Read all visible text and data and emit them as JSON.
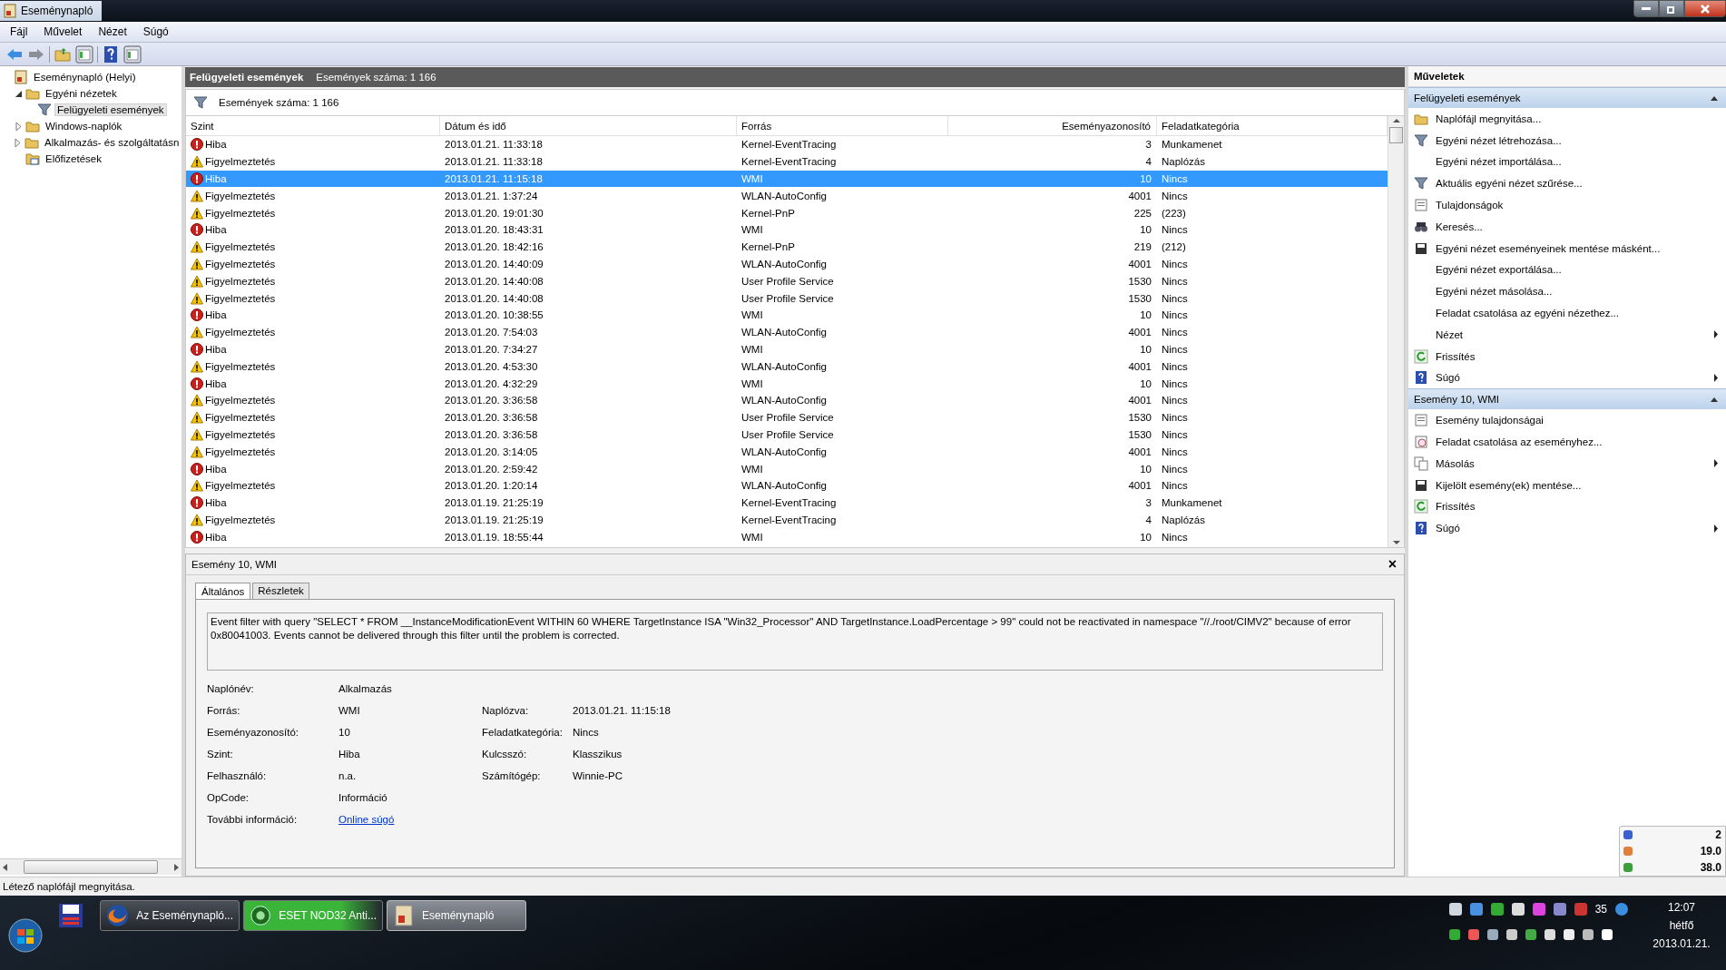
{
  "window": {
    "title": "Eseménynapló"
  },
  "menu": [
    "Fájl",
    "Művelet",
    "Nézet",
    "Súgó"
  ],
  "toolbar": [
    {
      "kind": "back"
    },
    {
      "kind": "forward"
    },
    {
      "kind": "sep"
    },
    {
      "kind": "folder-up"
    },
    {
      "kind": "pane"
    },
    {
      "kind": "sep"
    },
    {
      "kind": "help"
    },
    {
      "kind": "pane"
    }
  ],
  "tree": [
    {
      "label": "Eseménynapló (Helyi)",
      "kind": "root",
      "selected": false,
      "children": [
        {
          "label": "Egyéni nézetek",
          "kind": "folder",
          "expanded": true,
          "selected": false,
          "children": [
            {
              "label": "Felügyeleti események",
              "kind": "filter",
              "selected": true
            }
          ]
        },
        {
          "label": "Windows-naplók",
          "kind": "folder",
          "expanded": false,
          "selected": false
        },
        {
          "label": "Alkalmazás- és szolgáltatásn",
          "kind": "folder",
          "expanded": false,
          "selected": false
        },
        {
          "label": "Előfizetések",
          "kind": "subs",
          "selected": false
        }
      ]
    }
  ],
  "view_header": {
    "title": "Felügyeleti események",
    "count": "Események száma: 1 166"
  },
  "filter_bar": {
    "text": "Események száma: 1 166"
  },
  "table": {
    "columns": [
      "Szint",
      "Dátum és idő",
      "Forrás",
      "Eseményazonosító",
      "Feladatkategória"
    ],
    "rows": [
      {
        "kind": "error",
        "level": "Hiba",
        "date": "2013.01.21. 11:33:18",
        "source": "Kernel-EventTracing",
        "id": "3",
        "category": "Munkamenet",
        "selected": false
      },
      {
        "kind": "warning",
        "level": "Figyelmeztetés",
        "date": "2013.01.21. 11:33:18",
        "source": "Kernel-EventTracing",
        "id": "4",
        "category": "Naplózás",
        "selected": false
      },
      {
        "kind": "error",
        "level": "Hiba",
        "date": "2013.01.21. 11:15:18",
        "source": "WMI",
        "id": "10",
        "category": "Nincs",
        "selected": true
      },
      {
        "kind": "warning",
        "level": "Figyelmeztetés",
        "date": "2013.01.21. 1:37:24",
        "source": "WLAN-AutoConfig",
        "id": "4001",
        "category": "Nincs",
        "selected": false
      },
      {
        "kind": "warning",
        "level": "Figyelmeztetés",
        "date": "2013.01.20. 19:01:30",
        "source": "Kernel-PnP",
        "id": "225",
        "category": "(223)",
        "selected": false
      },
      {
        "kind": "error",
        "level": "Hiba",
        "date": "2013.01.20. 18:43:31",
        "source": "WMI",
        "id": "10",
        "category": "Nincs",
        "selected": false
      },
      {
        "kind": "warning",
        "level": "Figyelmeztetés",
        "date": "2013.01.20. 18:42:16",
        "source": "Kernel-PnP",
        "id": "219",
        "category": "(212)",
        "selected": false
      },
      {
        "kind": "warning",
        "level": "Figyelmeztetés",
        "date": "2013.01.20. 14:40:09",
        "source": "WLAN-AutoConfig",
        "id": "4001",
        "category": "Nincs",
        "selected": false
      },
      {
        "kind": "warning",
        "level": "Figyelmeztetés",
        "date": "2013.01.20. 14:40:08",
        "source": "User Profile Service",
        "id": "1530",
        "category": "Nincs",
        "selected": false
      },
      {
        "kind": "warning",
        "level": "Figyelmeztetés",
        "date": "2013.01.20. 14:40:08",
        "source": "User Profile Service",
        "id": "1530",
        "category": "Nincs",
        "selected": false
      },
      {
        "kind": "error",
        "level": "Hiba",
        "date": "2013.01.20. 10:38:55",
        "source": "WMI",
        "id": "10",
        "category": "Nincs",
        "selected": false
      },
      {
        "kind": "warning",
        "level": "Figyelmeztetés",
        "date": "2013.01.20. 7:54:03",
        "source": "WLAN-AutoConfig",
        "id": "4001",
        "category": "Nincs",
        "selected": false
      },
      {
        "kind": "error",
        "level": "Hiba",
        "date": "2013.01.20. 7:34:27",
        "source": "WMI",
        "id": "10",
        "category": "Nincs",
        "selected": false
      },
      {
        "kind": "warning",
        "level": "Figyelmeztetés",
        "date": "2013.01.20. 4:53:30",
        "source": "WLAN-AutoConfig",
        "id": "4001",
        "category": "Nincs",
        "selected": false
      },
      {
        "kind": "error",
        "level": "Hiba",
        "date": "2013.01.20. 4:32:29",
        "source": "WMI",
        "id": "10",
        "category": "Nincs",
        "selected": false
      },
      {
        "kind": "warning",
        "level": "Figyelmeztetés",
        "date": "2013.01.20. 3:36:58",
        "source": "WLAN-AutoConfig",
        "id": "4001",
        "category": "Nincs",
        "selected": false
      },
      {
        "kind": "warning",
        "level": "Figyelmeztetés",
        "date": "2013.01.20. 3:36:58",
        "source": "User Profile Service",
        "id": "1530",
        "category": "Nincs",
        "selected": false
      },
      {
        "kind": "warning",
        "level": "Figyelmeztetés",
        "date": "2013.01.20. 3:36:58",
        "source": "User Profile Service",
        "id": "1530",
        "category": "Nincs",
        "selected": false
      },
      {
        "kind": "warning",
        "level": "Figyelmeztetés",
        "date": "2013.01.20. 3:14:05",
        "source": "WLAN-AutoConfig",
        "id": "4001",
        "category": "Nincs",
        "selected": false
      },
      {
        "kind": "error",
        "level": "Hiba",
        "date": "2013.01.20. 2:59:42",
        "source": "WMI",
        "id": "10",
        "category": "Nincs",
        "selected": false
      },
      {
        "kind": "warning",
        "level": "Figyelmeztetés",
        "date": "2013.01.20. 1:20:14",
        "source": "WLAN-AutoConfig",
        "id": "4001",
        "category": "Nincs",
        "selected": false
      },
      {
        "kind": "error",
        "level": "Hiba",
        "date": "2013.01.19. 21:25:19",
        "source": "Kernel-EventTracing",
        "id": "3",
        "category": "Munkamenet",
        "selected": false
      },
      {
        "kind": "warning",
        "level": "Figyelmeztetés",
        "date": "2013.01.19. 21:25:19",
        "source": "Kernel-EventTracing",
        "id": "4",
        "category": "Naplózás",
        "selected": false
      },
      {
        "kind": "error",
        "level": "Hiba",
        "date": "2013.01.19. 18:55:44",
        "source": "WMI",
        "id": "10",
        "category": "Nincs",
        "selected": false
      }
    ]
  },
  "detail": {
    "title": "Esemény 10, WMI",
    "close": "×",
    "tabs": [
      {
        "label": "Általános",
        "selected": true
      },
      {
        "label": "Részletek",
        "selected": false
      }
    ],
    "message": "Event filter with query \"SELECT * FROM __InstanceModificationEvent WITHIN 60 WHERE TargetInstance ISA \"Win32_Processor\" AND TargetInstance.LoadPercentage > 99\" could not be reactivated in namespace \"//./root/CIMV2\" because of error 0x80041003. Events cannot be delivered through this filter until the problem is corrected.",
    "fields": [
      [
        {
          "label": "Naplónév:",
          "value": "Alkalmazás"
        }
      ],
      [
        {
          "label": "Forrás:",
          "value": "WMI"
        },
        {
          "label": "Naplózva:",
          "value": "2013.01.21. 11:15:18"
        }
      ],
      [
        {
          "label": "Eseményazonosító:",
          "value": "10"
        },
        {
          "label": "Feladatkategória:",
          "value": "Nincs"
        }
      ],
      [
        {
          "label": "Szint:",
          "value": "Hiba"
        },
        {
          "label": "Kulcsszó:",
          "value": "Klasszikus"
        }
      ],
      [
        {
          "label": "Felhasználó:",
          "value": "n.a."
        },
        {
          "label": "Számítógép:",
          "value": "Winnie-PC"
        }
      ],
      [
        {
          "label": "OpCode:",
          "value": "Információ"
        }
      ],
      [
        {
          "label": "További információ:",
          "link": "Online súgó"
        }
      ]
    ]
  },
  "actions": {
    "title": "Műveletek",
    "sections": [
      {
        "title": "Felügyeleti események",
        "expanded": true,
        "items": [
          {
            "label": "Naplófájl megnyitása...",
            "kind": "folder",
            "submenu": false
          },
          {
            "label": "Egyéni nézet létrehozása...",
            "kind": "filter",
            "submenu": false
          },
          {
            "label": "Egyéni nézet importálása...",
            "kind": "none",
            "submenu": false
          },
          {
            "label": "Aktuális egyéni nézet szűrése...",
            "kind": "filter",
            "submenu": false
          },
          {
            "label": "Tulajdonságok",
            "kind": "sheet",
            "submenu": false
          },
          {
            "label": "Keresés...",
            "kind": "binoculars",
            "submenu": false
          },
          {
            "label": "Egyéni nézet eseményeinek mentése másként...",
            "kind": "save",
            "submenu": false
          },
          {
            "label": "Egyéni nézet exportálása...",
            "kind": "none",
            "submenu": false
          },
          {
            "label": "Egyéni nézet másolása...",
            "kind": "none",
            "submenu": false
          },
          {
            "label": "Feladat csatolása az egyéni nézethez...",
            "kind": "none",
            "submenu": false
          },
          {
            "label": "Nézet",
            "kind": "none",
            "submenu": true
          },
          {
            "label": "Frissítés",
            "kind": "refresh",
            "submenu": false
          },
          {
            "label": "Súgó",
            "kind": "help",
            "submenu": true
          }
        ]
      },
      {
        "title": "Esemény 10, WMI",
        "expanded": true,
        "items": [
          {
            "label": "Esemény tulajdonságai",
            "kind": "sheet",
            "submenu": false
          },
          {
            "label": "Feladat csatolása az eseményhez...",
            "kind": "clock",
            "submenu": false
          },
          {
            "label": "Másolás",
            "kind": "copy",
            "submenu": true
          },
          {
            "label": "Kijelölt esemény(ek) mentése...",
            "kind": "save",
            "submenu": false
          },
          {
            "label": "Frissítés",
            "kind": "refresh",
            "submenu": false
          },
          {
            "label": "Súgó",
            "kind": "help",
            "submenu": true
          }
        ]
      }
    ]
  },
  "gadget": [
    "2",
    "19.0",
    "38.0"
  ],
  "status_bar": "Létező naplófájl megnyitása.",
  "taskbar": {
    "buttons": [
      {
        "label": "Az Eseménynapló...",
        "kind": "browser",
        "selected": false
      },
      {
        "label": "ESET NOD32 Anti...",
        "kind": "antivirus",
        "selected": false
      },
      {
        "label": "Eseménynapló",
        "kind": "eventlog",
        "selected": true
      }
    ],
    "tray_count": "35",
    "time": "12:07",
    "day": "hétfő",
    "date": "2013.01.21."
  }
}
